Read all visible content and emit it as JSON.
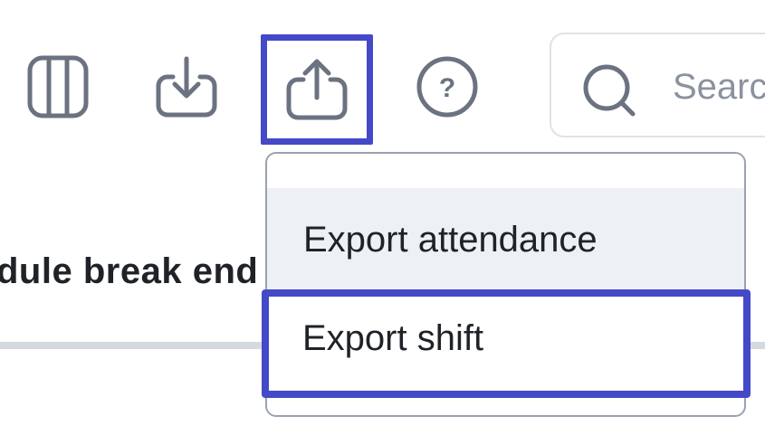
{
  "toolbar": {
    "columns_icon": "columns-icon",
    "download_icon": "download-icon",
    "export_icon": "upload-icon",
    "help_icon": "help-circle-icon",
    "help_glyph": "?"
  },
  "search": {
    "placeholder": "Search",
    "icon": "search-icon"
  },
  "page": {
    "heading_fragment": "dule break end"
  },
  "export_menu": {
    "items": [
      {
        "label": "Export attendance"
      },
      {
        "label": "Export shift"
      }
    ]
  },
  "colors": {
    "highlight": "#4449c8",
    "icon": "#6b7280",
    "text": "#1f2328",
    "hover_bg": "#edf0f4",
    "divider": "#d5dae1"
  }
}
